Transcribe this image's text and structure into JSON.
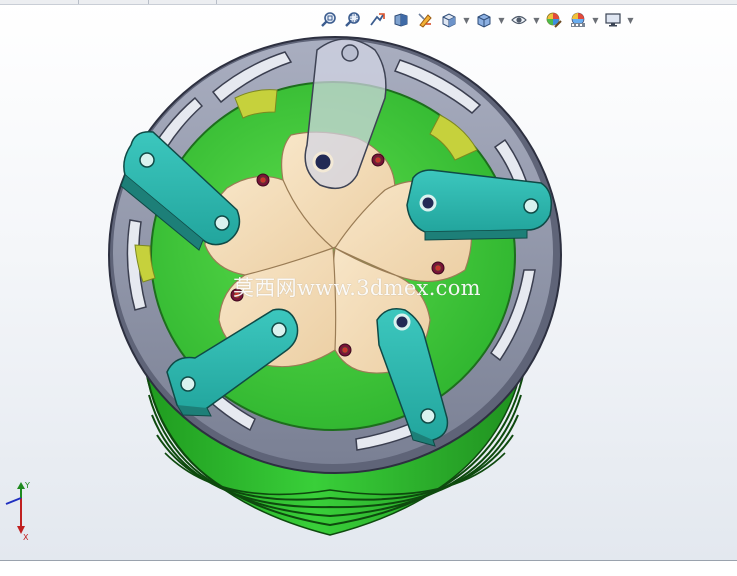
{
  "window": {
    "watermark_text": "莫西网www.3dmex.com"
  },
  "heads_up_toolbar": {
    "buttons": [
      {
        "name": "zoom-to-fit-icon",
        "has_dropdown": false
      },
      {
        "name": "zoom-to-area-icon",
        "has_dropdown": false
      },
      {
        "name": "previous-view-icon",
        "has_dropdown": false
      },
      {
        "name": "section-view-icon",
        "has_dropdown": false
      },
      {
        "name": "dynamic-annotation-icon",
        "has_dropdown": false
      },
      {
        "name": "view-orientation-icon",
        "has_dropdown": true
      },
      {
        "name": "display-style-icon",
        "has_dropdown": true
      },
      {
        "name": "hide-show-items-icon",
        "has_dropdown": true
      },
      {
        "name": "edit-appearance-icon",
        "has_dropdown": false
      },
      {
        "name": "apply-scene-icon",
        "has_dropdown": true
      },
      {
        "name": "view-settings-icon",
        "has_dropdown": true
      }
    ]
  },
  "triad_axes": {
    "x": "X",
    "y": "Y"
  },
  "colors": {
    "housing_metal": "#8e94a6",
    "housing_dark": "#5c6173",
    "base_green": "#2ec22e",
    "links_teal": "#33bdb4",
    "cams_wood": "#f3dcb8",
    "viewport_top": "#ffffff",
    "viewport_bottom": "#e3e8ef"
  }
}
